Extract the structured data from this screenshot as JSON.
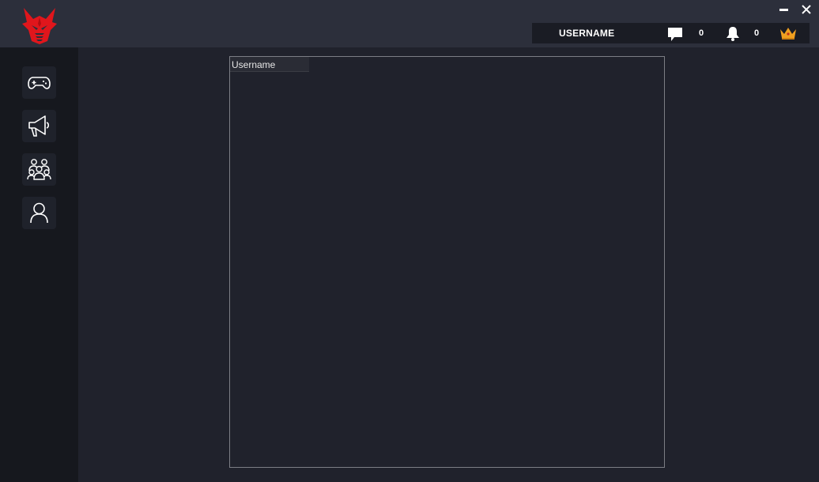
{
  "titlebar": {
    "logo_icon": "red-dragon-logo",
    "minimize_icon": "minimize-icon",
    "close_icon": "close-icon"
  },
  "userbar": {
    "username": "USERNAME",
    "messages_count": "0",
    "notifications_count": "0",
    "premium_icon": "crown-icon"
  },
  "sidebar": {
    "items": [
      {
        "name": "games",
        "icon": "gamepad-icon"
      },
      {
        "name": "announcements",
        "icon": "megaphone-icon"
      },
      {
        "name": "community",
        "icon": "group-icon"
      },
      {
        "name": "profile",
        "icon": "user-icon"
      }
    ]
  },
  "list": {
    "columns": [
      "Username"
    ],
    "rows": []
  },
  "colors": {
    "background": "#20222c",
    "titlebar": "#2c2f3b",
    "sidebar": "#16181e",
    "accent_red": "#e0161c",
    "crown_gold": "#f0a020"
  }
}
